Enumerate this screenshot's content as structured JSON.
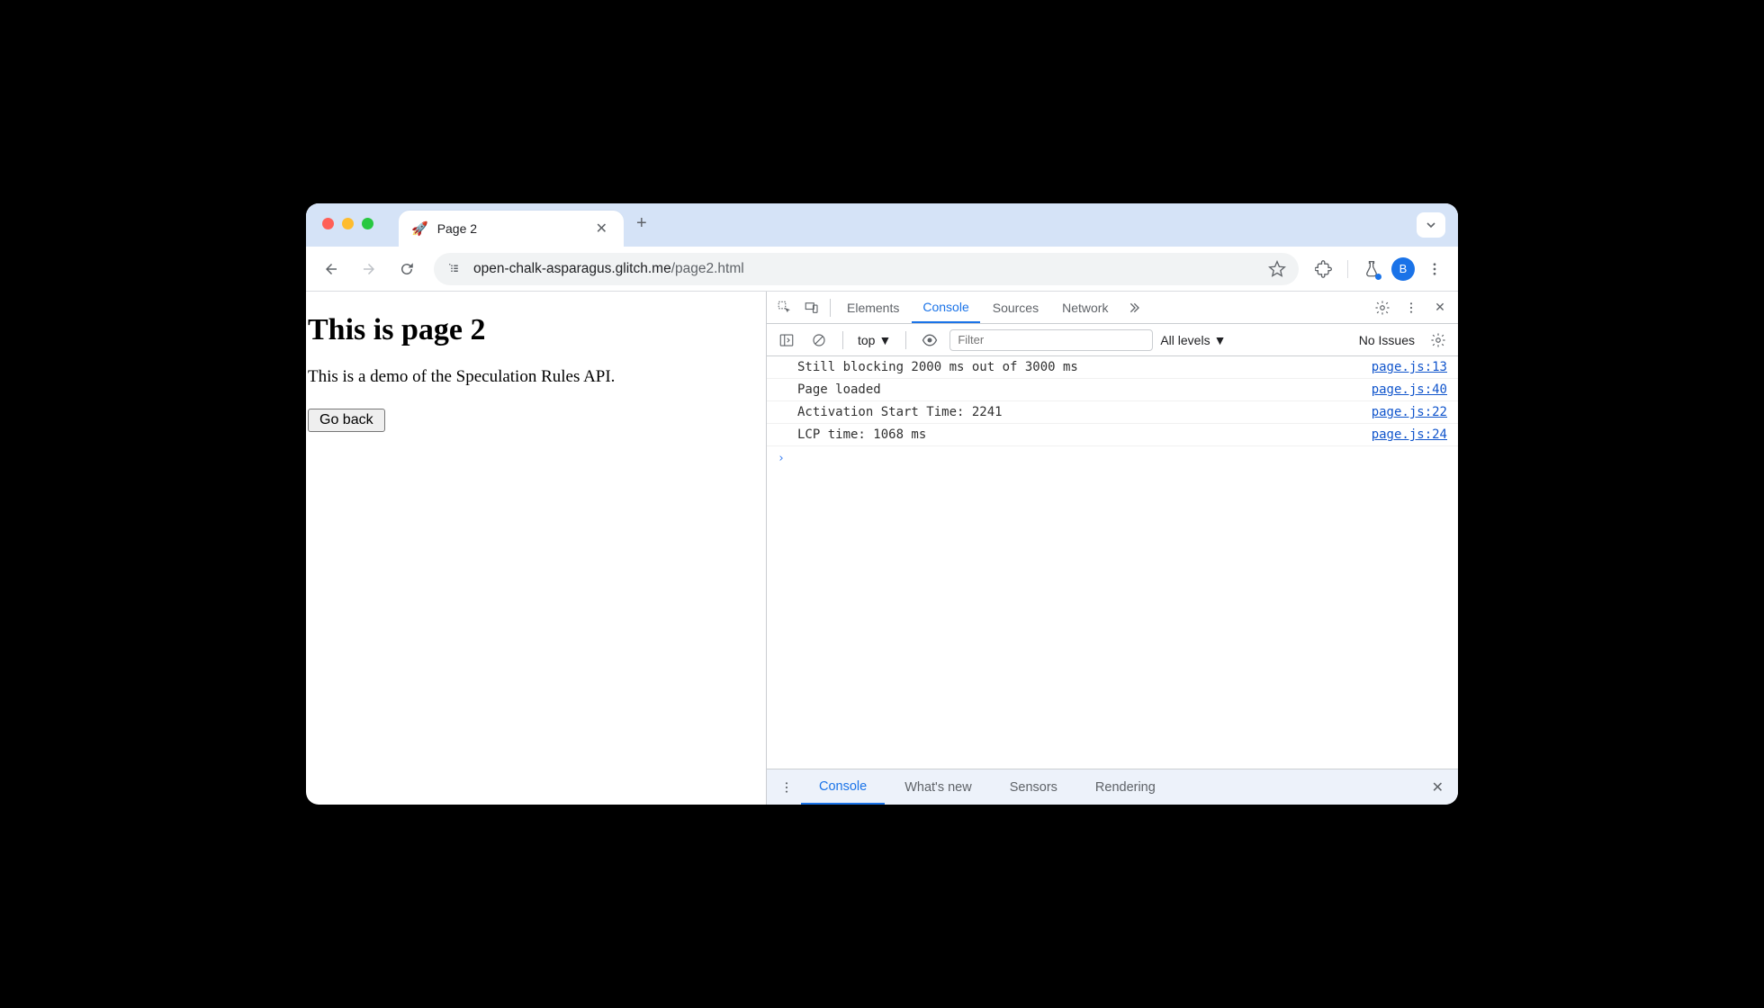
{
  "browser": {
    "tab": {
      "title": "Page 2",
      "favicon": "🚀"
    },
    "url": {
      "host": "open-chalk-asparagus.glitch.me",
      "path": "/page2.html"
    },
    "avatar_letter": "B"
  },
  "page": {
    "heading": "This is page 2",
    "paragraph": "This is a demo of the Speculation Rules API.",
    "button_label": "Go back"
  },
  "devtools": {
    "tabs": {
      "elements": "Elements",
      "console": "Console",
      "sources": "Sources",
      "network": "Network"
    },
    "console_toolbar": {
      "context": "top",
      "filter_placeholder": "Filter",
      "levels": "All levels",
      "issues": "No Issues"
    },
    "logs": [
      {
        "msg": "Still blocking 2000 ms out of 3000 ms",
        "src": "page.js:13"
      },
      {
        "msg": "Page loaded",
        "src": "page.js:40"
      },
      {
        "msg": "Activation Start Time: 2241",
        "src": "page.js:22"
      },
      {
        "msg": "LCP time: 1068 ms",
        "src": "page.js:24"
      }
    ],
    "drawer": {
      "console": "Console",
      "whatsnew": "What's new",
      "sensors": "Sensors",
      "rendering": "Rendering"
    }
  }
}
